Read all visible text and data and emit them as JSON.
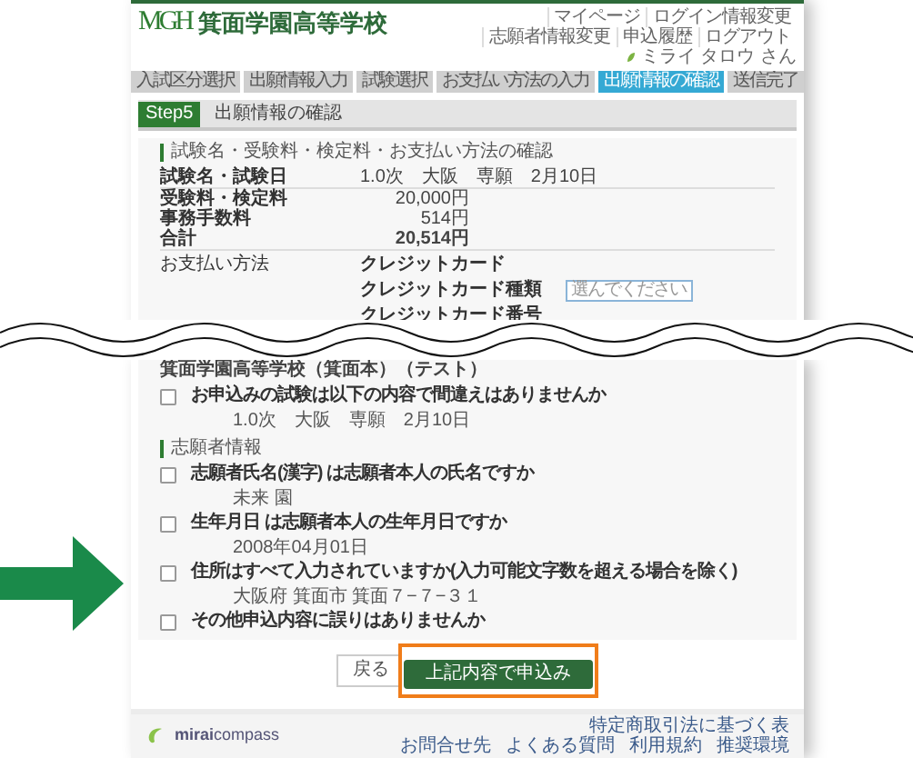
{
  "header": {
    "logo_letters": "MGH",
    "school_name": "箕面学園高等学校",
    "nav": [
      "マイページ",
      "ログイン情報変更",
      "志願者情報変更",
      "申込履歴",
      "ログアウト"
    ],
    "user": "ミライ タロウ さん"
  },
  "steps": [
    {
      "label": "入試区分選択",
      "selected": false
    },
    {
      "label": "出願情報入力",
      "selected": false
    },
    {
      "label": "試験選択",
      "selected": false
    },
    {
      "label": "お支払い方法の入力",
      "selected": false
    },
    {
      "label": "出願情報の確認",
      "selected": true
    },
    {
      "label": "送信完了",
      "selected": false
    }
  ],
  "step_heading": {
    "badge": "Step5",
    "title": "出願情報の確認"
  },
  "fee_section": {
    "title": "試験名・受験料・検定料・お支払い方法の確認",
    "rows": [
      {
        "label": "試験名・試験日",
        "value": "1.0次　大阪　専願　2月10日",
        "bold": false
      },
      {
        "label": "受験料・検定料",
        "value": "20,000円",
        "bold": false
      },
      {
        "label": "事務手数料",
        "value": "514円",
        "bold": false
      },
      {
        "label": "合計",
        "value": "20,514円",
        "bold": true
      }
    ],
    "payment_label": "お支払い方法",
    "payment_method": "クレジットカード",
    "card_type_label": "クレジットカード種類",
    "card_type_placeholder": "選んでください",
    "card_number_label": "クレジットカード番号"
  },
  "exam_school": "箕面学園高等学校（箕面本）（テスト）",
  "exam_check": {
    "question": "お申込みの試験は以下の内容で間違えはありませんか",
    "answer": "1.0次　大阪　専願　2月10日",
    "checked": false
  },
  "applicant_section": {
    "title": "志願者情報",
    "checks": [
      {
        "question": "志願者氏名(漢字) は志願者本人の氏名ですか",
        "answer": "未来 園",
        "checked": false
      },
      {
        "question": "生年月日 は志願者本人の生年月日ですか",
        "answer": "2008年04月01日",
        "checked": false
      },
      {
        "question": "住所はすべて入力されていますか(入力可能文字数を超える場合を除く)",
        "answer": "大阪府 箕面市 箕面７−７−３１",
        "checked": false
      },
      {
        "question": "その他申込内容に誤りはありませんか",
        "checked": false
      }
    ]
  },
  "buttons": {
    "back": "戻る",
    "submit": "上記内容で申込み"
  },
  "footer": {
    "brand": "**mirai**compass",
    "links_top": [
      "特定商取引法に基づく表"
    ],
    "links": [
      "お問合せ先",
      "よくある質問",
      "利用規約",
      "推奨環境"
    ]
  }
}
